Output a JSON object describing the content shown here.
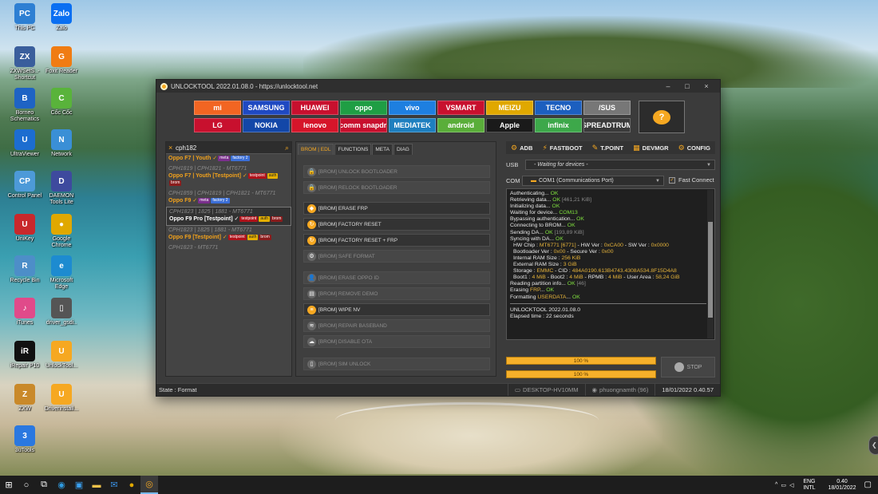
{
  "desktop": {
    "icons": [
      {
        "label": "This PC",
        "glyph": "PC",
        "color": "#2d7fd3"
      },
      {
        "label": "Zalo",
        "glyph": "Zalo",
        "color": "#0a6ff2"
      },
      {
        "label": "ZXWSetS..-Shortcut",
        "glyph": "ZX",
        "color": "#3a5e9c"
      },
      {
        "label": "Foxit Reader",
        "glyph": "G",
        "color": "#f07c12"
      },
      {
        "label": "Borneo Schematics",
        "glyph": "B",
        "color": "#1e63c4"
      },
      {
        "label": "Cốc Cốc",
        "glyph": "C",
        "color": "#59b33b"
      },
      {
        "label": "UltraViewer",
        "glyph": "U",
        "color": "#1c6dd0"
      },
      {
        "label": "Network",
        "glyph": "N",
        "color": "#3a8fd6"
      },
      {
        "label": "Control Panel",
        "glyph": "CP",
        "color": "#4d9ad8"
      },
      {
        "label": "DAEMON Tools Lite",
        "glyph": "D",
        "color": "#3e4a9e"
      },
      {
        "label": "UniKey",
        "glyph": "U",
        "color": "#c8282c"
      },
      {
        "label": "Google Chrome",
        "glyph": "●",
        "color": "#e0a800"
      },
      {
        "label": "Recycle Bin",
        "glyph": "R",
        "color": "#4d8ec8"
      },
      {
        "label": "Microsoft Edge",
        "glyph": "e",
        "color": "#1d8bd0"
      },
      {
        "label": "iTunes",
        "glyph": "♪",
        "color": "#e04a8a"
      },
      {
        "label": "driver_gsdi..",
        "glyph": "▯",
        "color": "#555555"
      },
      {
        "label": "iRepair P10",
        "glyph": "iR",
        "color": "#111111"
      },
      {
        "label": "UnlockTool...",
        "glyph": "U",
        "color": "#f6a821"
      },
      {
        "label": "ZXW",
        "glyph": "Z",
        "color": "#c9892a"
      },
      {
        "label": "Driverinstall...",
        "glyph": "U",
        "color": "#f6a821"
      },
      {
        "label": "3uTools",
        "glyph": "3",
        "color": "#2a78e0"
      }
    ]
  },
  "window": {
    "title": "UNLOCKTOOL 2022.01.08.0 - https://unlocktool.net",
    "min": "–",
    "max": "□",
    "close": "×"
  },
  "brands": [
    {
      "label": "mi",
      "bg": "#f26522"
    },
    {
      "label": "SAMSUNG",
      "bg": "#1f49c2"
    },
    {
      "label": "HUAWEI",
      "bg": "#c8102e"
    },
    {
      "label": "oppo",
      "bg": "#1f9e44"
    },
    {
      "label": "vivo",
      "bg": "#1e7fe0"
    },
    {
      "label": "VSMART",
      "bg": "#c8102e"
    },
    {
      "label": "MEIZU",
      "bg": "#e0a800"
    },
    {
      "label": "TECNO",
      "bg": "#1c5fbf"
    },
    {
      "label": "/SUS",
      "bg": "#777777"
    },
    {
      "label": "LG",
      "bg": "#c8102e"
    },
    {
      "label": "NOKIA",
      "bg": "#1347a8"
    },
    {
      "label": "lenovo",
      "bg": "#d6152a"
    },
    {
      "label": "Qualcomm snapdragon",
      "bg": "#c8102e"
    },
    {
      "label": "MEDIATEK",
      "bg": "#1e7fbf"
    },
    {
      "label": "android",
      "bg": "#5aae3a"
    },
    {
      "label": "Apple",
      "bg": "#1a1a1a"
    },
    {
      "label": "infinix",
      "bg": "#3da84a"
    },
    {
      "label": "SPREADTRUM",
      "bg": "#3a3a3a"
    }
  ],
  "search": {
    "value": "cph182",
    "clear_icon": "×",
    "search_icon": "⌕"
  },
  "models": [
    {
      "sub": "",
      "name": "Oppo F7 | Youth ✓",
      "tags": [
        [
          "meta",
          "t-meta"
        ],
        [
          "factory 2",
          "t-factory"
        ]
      ],
      "white": false,
      "selected": false
    },
    {
      "sub": "CPH1819 | CPH1821 - MT6771",
      "name": "Oppo F7 | Youth [Testpoint] ✓",
      "tags": [
        [
          "testpoint",
          "t-test"
        ],
        [
          "auth",
          "t-auth"
        ],
        [
          "brom",
          "t-brom"
        ]
      ],
      "white": false,
      "selected": false
    },
    {
      "sub": "CPH1859 | CPH1819 | CPH1821 - MT6771",
      "name": "Oppo F9 ✓",
      "tags": [
        [
          "meta",
          "t-meta"
        ],
        [
          "factory 2",
          "t-factory"
        ]
      ],
      "white": false,
      "selected": false
    },
    {
      "sub": "CPH1823 | 1825 | 1881 - MT6771",
      "name": "Oppo F9 Pro [Testpoint] ✓",
      "tags": [
        [
          "testpoint",
          "t-test"
        ],
        [
          "auth",
          "t-auth"
        ],
        [
          "brom",
          "t-brom"
        ]
      ],
      "white": true,
      "selected": true
    },
    {
      "sub": "CPH1823 | 1825 | 1881 - MT6771",
      "name": "Oppo F9 [Testpoint] ✓",
      "tags": [
        [
          "testpoint",
          "t-test"
        ],
        [
          "auth",
          "t-auth"
        ],
        [
          "brom",
          "t-brom"
        ]
      ],
      "white": false,
      "selected": false
    },
    {
      "sub": "CPH1823 - MT6771",
      "name": "",
      "tags": [],
      "white": false,
      "selected": false
    }
  ],
  "tabs": [
    "BROM | EDL",
    "FUNCTIONS",
    "META",
    "DIAG"
  ],
  "functions": [
    {
      "label": "[BROM] UNLOCK BOOTLOADER",
      "on": false,
      "icon": "🔒"
    },
    {
      "label": "[BROM] RELOCK BOOTLOADER",
      "on": false,
      "icon": "🔒"
    },
    {
      "label": "[BROM] ERASE FRP",
      "on": true,
      "icon": "◆"
    },
    {
      "label": "[BROM] FACTORY RESET",
      "on": true,
      "icon": "↻"
    },
    {
      "label": "[BROM] FACTORY RESET + FRP",
      "on": true,
      "icon": "↻"
    },
    {
      "label": "[BROM] SAFE FORMAT",
      "on": false,
      "icon": "⚙"
    },
    {
      "label": "[BROM] ERASE OPPO ID",
      "on": false,
      "icon": "👤"
    },
    {
      "label": "[BROM] REMOVE DEMO",
      "on": false,
      "icon": "▤"
    },
    {
      "label": "[BROM] WIPE NV",
      "on": true,
      "icon": "≡"
    },
    {
      "label": "[BROM] REPAIR BASEBAND",
      "on": false,
      "icon": "≋"
    },
    {
      "label": "[BROM] DISABLE OTA",
      "on": false,
      "icon": "☁"
    },
    {
      "label": "[BROM] SIM UNLOCK",
      "on": false,
      "icon": "▯"
    }
  ],
  "tools": [
    {
      "label": "ADB",
      "icon": "⚙"
    },
    {
      "label": "FASTBOOT",
      "icon": "⚡"
    },
    {
      "label": "T.POINT",
      "icon": "✎"
    },
    {
      "label": "DEVMGR",
      "icon": "▦"
    },
    {
      "label": "CONFIG",
      "icon": "⚙"
    }
  ],
  "usb": {
    "label": "USB",
    "value": "- Waiting for devices -"
  },
  "com": {
    "label": "COM",
    "value": "COM1 (Communications Port)",
    "fast_connect": "Fast Connect"
  },
  "log": [
    [
      [
        "Authenticating... ",
        ""
      ],
      [
        "OK",
        "lg-ok"
      ]
    ],
    [
      [
        "Retrieving data... ",
        ""
      ],
      [
        "OK ",
        "lg-ok"
      ],
      [
        "[461,21 KiB]",
        "lg-dim"
      ]
    ],
    [
      [
        "Initializing data... ",
        ""
      ],
      [
        "OK",
        "lg-ok"
      ]
    ],
    [
      [
        "Waiting for device... ",
        ""
      ],
      [
        "COM13",
        "lg-ok"
      ]
    ],
    [
      [
        "Bypassing authentication... ",
        ""
      ],
      [
        "OK",
        "lg-ok"
      ]
    ],
    [
      [
        "Connecting to BROM... ",
        ""
      ],
      [
        "OK",
        "lg-ok"
      ]
    ],
    [
      [
        "Sending DA... ",
        ""
      ],
      [
        "OK ",
        "lg-ok"
      ],
      [
        "[193,89 KiB]",
        "lg-dim"
      ]
    ],
    [
      [
        "Syncing with DA... ",
        ""
      ],
      [
        "OK",
        "lg-ok"
      ]
    ],
    [
      [
        "  HW Chip : ",
        ""
      ],
      [
        "MT6771 [6771]",
        "lg-val"
      ],
      [
        " - HW Ver : ",
        ""
      ],
      [
        "0xCA00",
        "lg-val"
      ],
      [
        " - SW Ver : ",
        ""
      ],
      [
        "0x0000",
        "lg-val"
      ]
    ],
    [
      [
        "  Bootloader Ver : ",
        ""
      ],
      [
        "0x00",
        "lg-val"
      ],
      [
        " - Secure Ver : ",
        ""
      ],
      [
        "0x00",
        "lg-val"
      ]
    ],
    [
      [
        "  Internal RAM Size : ",
        ""
      ],
      [
        "256 KiB",
        "lg-val"
      ]
    ],
    [
      [
        "  External RAM Size : ",
        ""
      ],
      [
        "3 GiB",
        "lg-val"
      ]
    ],
    [
      [
        "  Storage : ",
        ""
      ],
      [
        "EMMC",
        "lg-val"
      ],
      [
        " - CID : ",
        ""
      ],
      [
        "484A0190.613B4743.4308A534.8F15D4A8",
        "lg-val"
      ]
    ],
    [
      [
        "  Boot1 : ",
        ""
      ],
      [
        "4 MiB",
        "lg-val"
      ],
      [
        " - Boot2 : ",
        ""
      ],
      [
        "4 MiB",
        "lg-val"
      ],
      [
        " - RPMB : ",
        ""
      ],
      [
        "4 MiB",
        "lg-val"
      ],
      [
        " - User Area : ",
        ""
      ],
      [
        "58,24 GiB",
        "lg-val"
      ]
    ],
    [
      [
        "Reading partition info... ",
        ""
      ],
      [
        "OK ",
        "lg-ok"
      ],
      [
        "[46]",
        "lg-dim"
      ]
    ],
    [
      [
        "Erasing ",
        ""
      ],
      [
        "FRP",
        "lg-val"
      ],
      [
        "... ",
        ""
      ],
      [
        "OK",
        "lg-ok"
      ]
    ],
    [
      [
        "Formatting ",
        ""
      ],
      [
        "USERDATA",
        "lg-val"
      ],
      [
        "... ",
        ""
      ],
      [
        "OK",
        "lg-ok"
      ]
    ]
  ],
  "log_footer": {
    "version": "UNLOCKTOOL 2022.01.08.0",
    "elapsed": "Elapsed time : 22 seconds"
  },
  "progress": {
    "bar1": "100 %",
    "bar2": "100 %",
    "fraction": 1.0
  },
  "stop_label": "STOP",
  "status": {
    "state": "State : Format",
    "computer": "DESKTOP-HV10MM",
    "user": "phuongnamth (96)",
    "datetime": "18/01/2022 0.40.57"
  },
  "taskbar": {
    "lang": "ENG",
    "lang2": "INTL",
    "time": "0.40",
    "date": "18/01/2022"
  }
}
